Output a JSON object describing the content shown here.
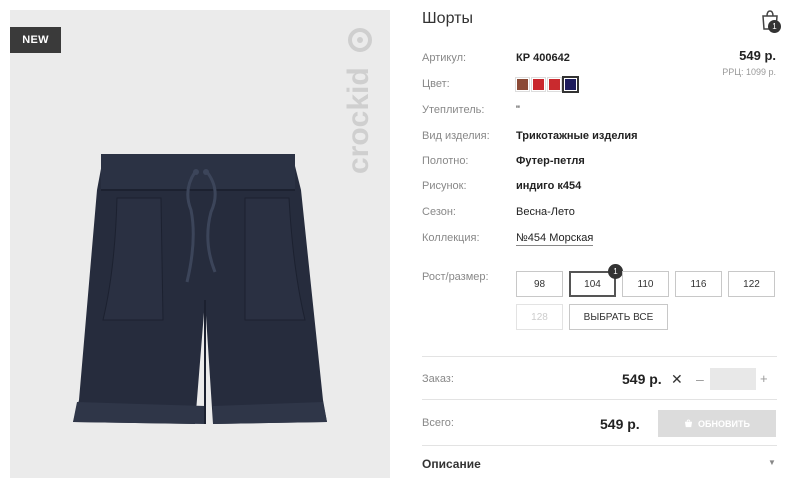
{
  "image": {
    "badge": "NEW",
    "brand": "crockid"
  },
  "product": {
    "title": "Шорты",
    "price": "549 р.",
    "rrp": "РРЦ: 1099 р."
  },
  "cart": {
    "icon": "shopping-bag-icon",
    "count": "1"
  },
  "attributes": [
    {
      "label": "Артикул:",
      "value": "КР 400642"
    },
    {
      "label": "Цвет:",
      "value": ""
    },
    {
      "label": "Утеплитель:",
      "value": "\""
    },
    {
      "label": "Вид изделия:",
      "value": "Трикотажные изделия"
    },
    {
      "label": "Полотно:",
      "value": "Футер-петля"
    },
    {
      "label": "Рисунок:",
      "value": "индиго к454"
    },
    {
      "label": "Сезон:",
      "value": "Весна-Лето"
    },
    {
      "label": "Коллекция:",
      "value": "№454 Морская"
    }
  ],
  "colors": [
    "#8b4a36",
    "#c9262c",
    "#c92a2e",
    "#1c1b5c"
  ],
  "sizes": {
    "label": "Рост/размер:",
    "options": [
      "98",
      "104",
      "110",
      "116",
      "122",
      "128"
    ],
    "selected": "104",
    "selected_count": "1",
    "disabled": "128",
    "select_all": "ВЫБРАТЬ ВСЕ"
  },
  "order": {
    "label": "Заказ:",
    "price": "549 р.",
    "remove": "✕",
    "minus": "–",
    "plus": "+",
    "quantity": ""
  },
  "total": {
    "label": "Всего:",
    "price": "549 р.",
    "update_label": "ОБНОВИТЬ",
    "update_icon": "cart-icon"
  },
  "description": {
    "label": "Описание"
  }
}
